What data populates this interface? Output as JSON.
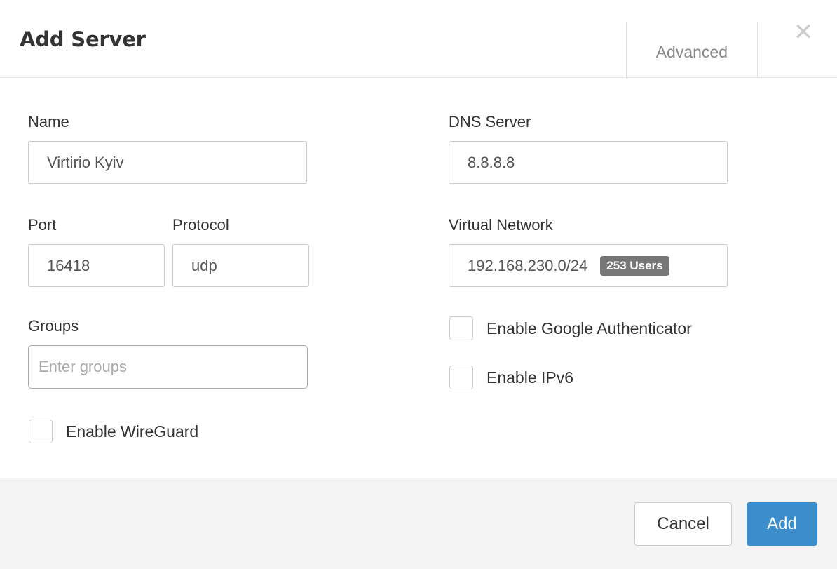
{
  "header": {
    "title": "Add Server",
    "tabs": [
      {
        "label": "Advanced",
        "name": "tab-advanced"
      }
    ],
    "close_icon": "close-icon",
    "close_glyph": "✕"
  },
  "form": {
    "left": {
      "name_label": "Name",
      "name_value": "Virtirio Kyiv",
      "port_label": "Port",
      "port_value": "16418",
      "protocol_label": "Protocol",
      "protocol_value": "udp",
      "groups_label": "Groups",
      "groups_placeholder": "Enter groups",
      "groups_value": "",
      "wireguard_label": "Enable WireGuard",
      "wireguard_checked": false
    },
    "right": {
      "dns_label": "DNS Server",
      "dns_value": "8.8.8.8",
      "vnet_label": "Virtual Network",
      "vnet_value": "192.168.230.0/24",
      "vnet_badge": "253 Users",
      "google_auth_label": "Enable Google Authenticator",
      "google_auth_checked": false,
      "ipv6_label": "Enable IPv6",
      "ipv6_checked": false
    }
  },
  "footer": {
    "cancel_label": "Cancel",
    "add_label": "Add"
  },
  "colors": {
    "primary": "#3c8dcc",
    "badge_bg": "#777777",
    "footer_bg": "#f4f4f4",
    "border": "#cccccc",
    "text": "#333333",
    "muted_text": "#888888"
  }
}
